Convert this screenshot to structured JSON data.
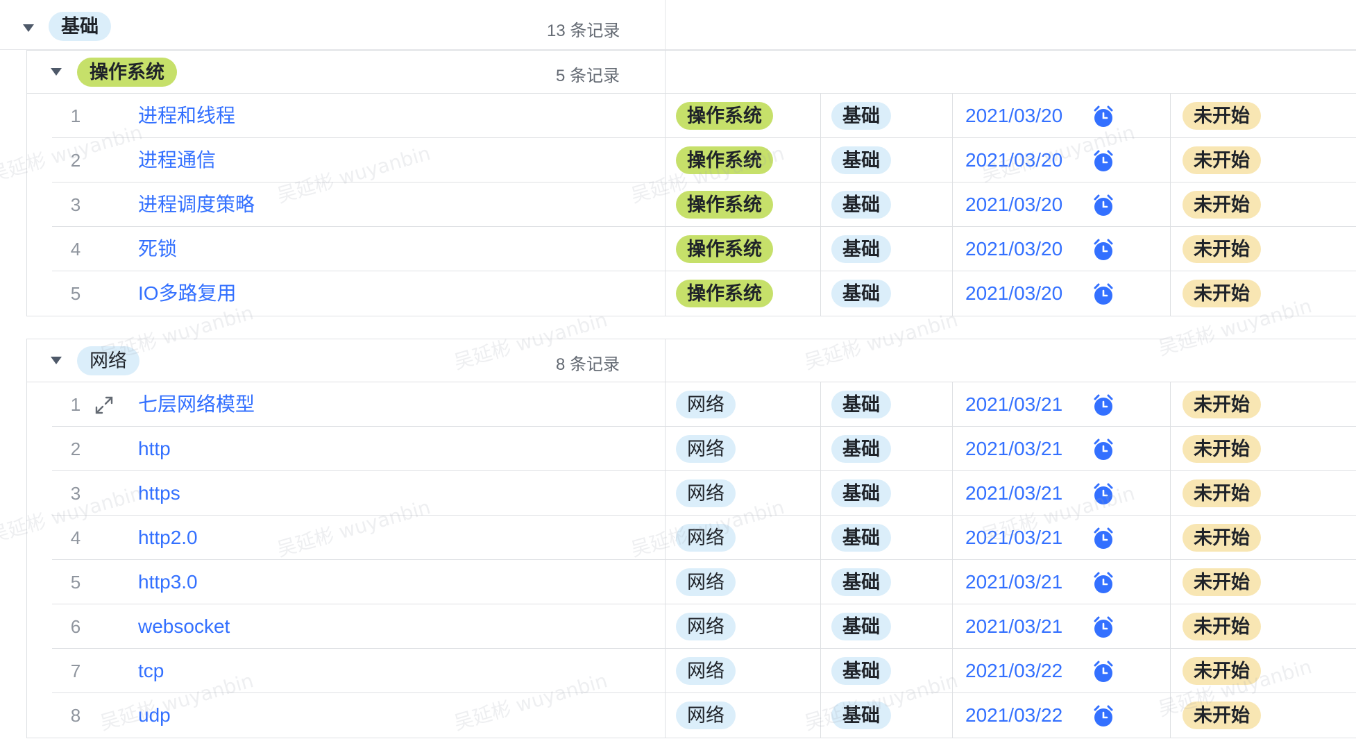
{
  "top_group": {
    "label": "基础",
    "count": "13 条记录"
  },
  "groups": [
    {
      "label": "操作系统",
      "count": "5 条记录",
      "rows": [
        {
          "index": "1",
          "title": "进程和线程",
          "category": "操作系统",
          "level": "基础",
          "date": "2021/03/20",
          "status": "未开始"
        },
        {
          "index": "2",
          "title": "进程通信",
          "category": "操作系统",
          "level": "基础",
          "date": "2021/03/20",
          "status": "未开始"
        },
        {
          "index": "3",
          "title": "进程调度策略",
          "category": "操作系统",
          "level": "基础",
          "date": "2021/03/20",
          "status": "未开始"
        },
        {
          "index": "4",
          "title": "死锁",
          "category": "操作系统",
          "level": "基础",
          "date": "2021/03/20",
          "status": "未开始"
        },
        {
          "index": "5",
          "title": "IO多路复用",
          "category": "操作系统",
          "level": "基础",
          "date": "2021/03/20",
          "status": "未开始"
        }
      ]
    },
    {
      "label": "网络",
      "count": "8 条记录",
      "rows": [
        {
          "index": "1",
          "title": "七层网络模型",
          "category": "网络",
          "level": "基础",
          "date": "2021/03/21",
          "status": "未开始"
        },
        {
          "index": "2",
          "title": "http",
          "category": "网络",
          "level": "基础",
          "date": "2021/03/21",
          "status": "未开始"
        },
        {
          "index": "3",
          "title": "https",
          "category": "网络",
          "level": "基础",
          "date": "2021/03/21",
          "status": "未开始"
        },
        {
          "index": "4",
          "title": "http2.0",
          "category": "网络",
          "level": "基础",
          "date": "2021/03/21",
          "status": "未开始"
        },
        {
          "index": "5",
          "title": "http3.0",
          "category": "网络",
          "level": "基础",
          "date": "2021/03/21",
          "status": "未开始"
        },
        {
          "index": "6",
          "title": "websocket",
          "category": "网络",
          "level": "基础",
          "date": "2021/03/21",
          "status": "未开始"
        },
        {
          "index": "7",
          "title": "tcp",
          "category": "网络",
          "level": "基础",
          "date": "2021/03/22",
          "status": "未开始"
        },
        {
          "index": "8",
          "title": "udp",
          "category": "网络",
          "level": "基础",
          "date": "2021/03/22",
          "status": "未开始"
        }
      ]
    }
  ],
  "watermark": "吴延彬 wuyanbin",
  "colors": {
    "link": "#3370ff",
    "tag_os": "#c6e06a",
    "tag_blue": "#dbeefa",
    "tag_status": "#f8e6b3",
    "clock": "#3370ff"
  },
  "icons": {
    "collapse": "caret-down-icon",
    "expand_record": "expand-arrows-icon",
    "reminder": "alarm-clock-icon"
  }
}
